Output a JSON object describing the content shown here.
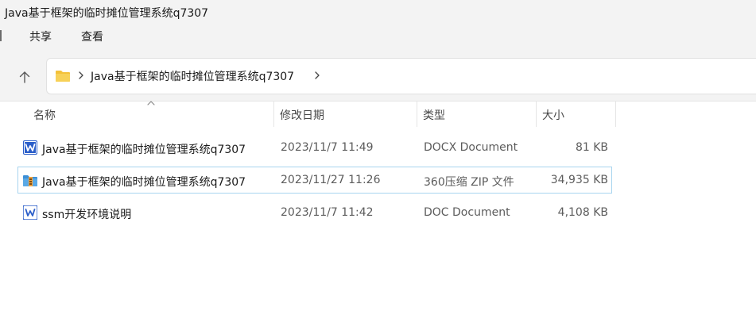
{
  "window": {
    "title": "Java基于框架的临时摊位管理系统q7307"
  },
  "ribbon": {
    "tabs": [
      {
        "label": "共享"
      },
      {
        "label": "查看"
      }
    ]
  },
  "address": {
    "path": "Java基于框架的临时摊位管理系统q7307"
  },
  "columns": {
    "name": "名称",
    "date": "修改日期",
    "type": "类型",
    "size": "大小"
  },
  "files": [
    {
      "name": "Java基于框架的临时摊位管理系统q7307",
      "date": "2023/11/7 11:49",
      "type": "DOCX Document",
      "size": "81 KB",
      "icon": "word-doc-icon"
    },
    {
      "name": "Java基于框架的临时摊位管理系统q7307",
      "date": "2023/11/27 11:26",
      "type": "360压缩 ZIP 文件",
      "size": "34,935 KB",
      "icon": "zip-archive-icon",
      "selected": true
    },
    {
      "name": "ssm开发环境说明",
      "date": "2023/11/7 11:42",
      "type": "DOC Document",
      "size": "4,108 KB",
      "icon": "word-doc-icon"
    }
  ],
  "colors": {
    "chrome_bg": "#f3f3f3",
    "selection_border": "#a8d4ef",
    "word_blue": "#2b5ec9",
    "folder_yellow": "#f3c13a"
  }
}
